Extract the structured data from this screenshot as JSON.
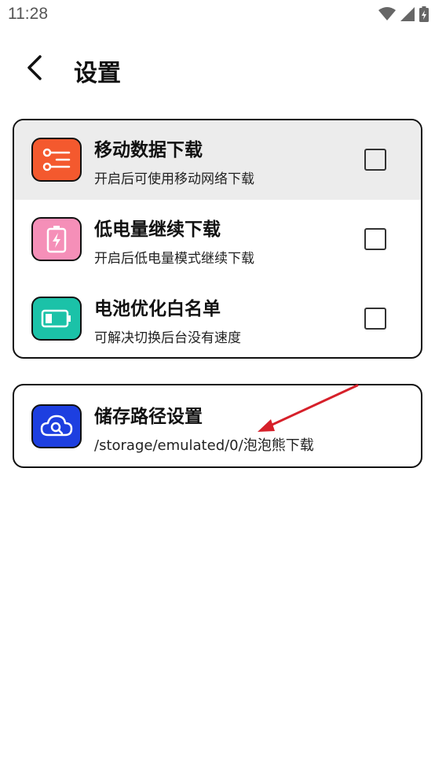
{
  "status_bar": {
    "time": "11:28",
    "icons": [
      "wifi-icon",
      "signal-icon",
      "battery-charging-icon"
    ]
  },
  "header": {
    "back_icon": "chevron-left-icon",
    "title": "设置"
  },
  "settings": [
    {
      "title": "移动数据下载",
      "subtitle": "开启后可使用移动网络下载",
      "icon": "list-filter-icon",
      "icon_color": "#F4592E",
      "checked": false,
      "highlighted": true
    },
    {
      "title": "低电量继续下载",
      "subtitle": "开启后低电量模式继续下载",
      "icon": "battery-bolt-icon",
      "icon_color": "#F58FB8",
      "checked": false,
      "highlighted": false
    },
    {
      "title": "电池优化白名单",
      "subtitle": "可解决切换后台没有速度",
      "icon": "battery-icon",
      "icon_color": "#1BC2A8",
      "checked": false,
      "highlighted": false
    }
  ],
  "storage": {
    "title": "储存路径设置",
    "path": "/storage/emulated/0/泡泡熊下载",
    "icon": "cloud-search-icon",
    "icon_color": "#1D3FE0"
  },
  "colors": {
    "annotation_arrow": "#D6202A",
    "highlight_row": "#ECECEC"
  }
}
